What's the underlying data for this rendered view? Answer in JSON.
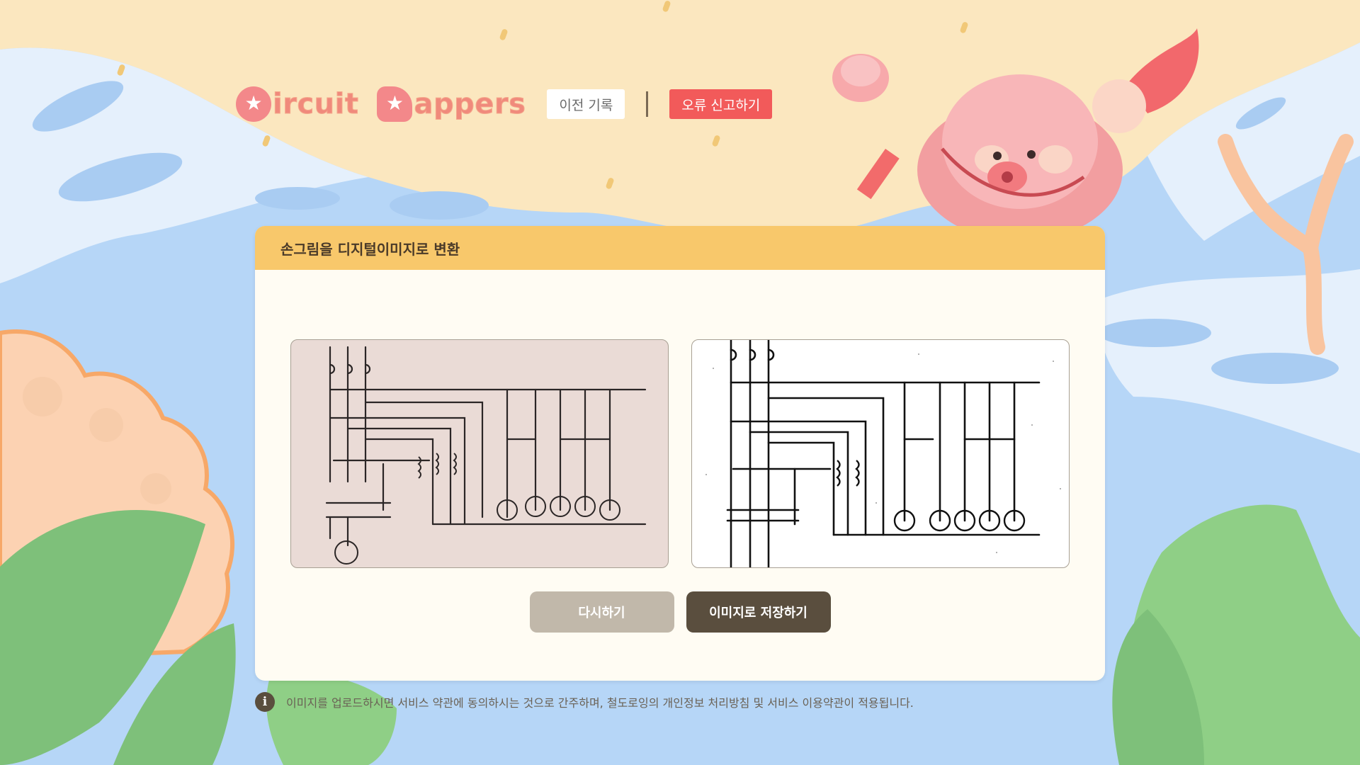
{
  "header": {
    "logo": {
      "word1_text": "ircuit",
      "word2_text": "appers"
    },
    "history_label": "이전 기록",
    "report_label": "오류 신고하기"
  },
  "card": {
    "title": "손그림을 디지털이미지로 변환",
    "original_image_desc": "hand-drawn circuit diagram photo",
    "converted_image_desc": "digitized circuit diagram",
    "retry_label": "다시하기",
    "save_label": "이미지로 저장하기"
  },
  "notice": {
    "icon": "info-icon",
    "text": "이미지를 업로드하시면 서비스 약관에 동의하시는 것으로 간주하며, 철도로잉의 개인정보 처리방침 및 서비스 이용약관이 적용됩니다."
  },
  "colors": {
    "sky": "#b6d6f7",
    "sand": "#fbe7bf",
    "card_header": "#f8c86b",
    "card_bg": "#fffcf3",
    "report_button": "#f25a5a",
    "retry_button": "#c1b8aa",
    "save_button": "#5a4e3e",
    "logo": "#f08a7c"
  }
}
